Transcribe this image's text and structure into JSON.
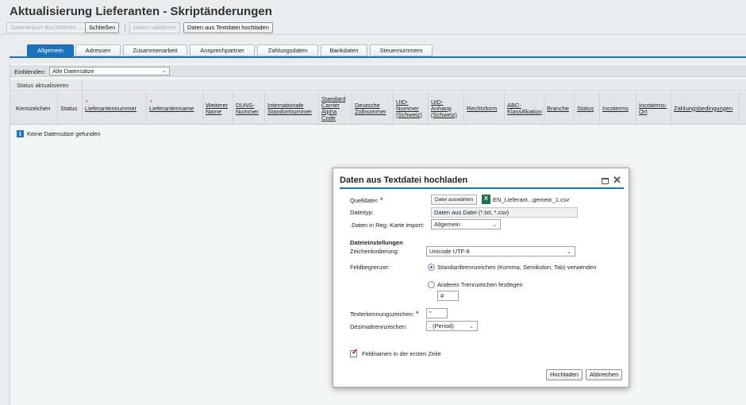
{
  "page": {
    "title": "Aktualisierung Lieferanten - Skriptänderungen"
  },
  "toolbar": {
    "import": "Datenimport durchführen",
    "import_dropdown": "⌄",
    "close": "Schließen",
    "validate": "Daten validieren",
    "upload": "Daten aus Textdatei hochladen"
  },
  "tabs": [
    {
      "label": "Allgemein",
      "active": true
    },
    {
      "label": "Adressen"
    },
    {
      "label": "Zusammenarbeit"
    },
    {
      "label": "Ansprechpartner"
    },
    {
      "label": "Zahlungsdaten"
    },
    {
      "label": "Bankdaten"
    },
    {
      "label": "Steuernummern"
    }
  ],
  "filter": {
    "label": "Einblenden:",
    "value": "Alle Datensätze"
  },
  "table": {
    "group_header": "Status aktualisieren",
    "columns": [
      "Kennzeichen",
      "Status",
      "Lieferantennummer",
      "Lieferantenname",
      "Weiterer Name",
      "DUNS-Nummer",
      "Internationale Standortnummer",
      "Standard Carrier Alpha Code",
      "Deutsche Zollnummer",
      "UID-Nummer (Schweiz)",
      "UID-Anhang (Schweiz)",
      "Rechtsform",
      "ABC-Klassifikation",
      "Branche",
      "Status",
      "Incoterms",
      "Incoterms-Ort",
      "Zahlungsbedingungen"
    ],
    "required_marker": "*",
    "empty_message": "Keine Datensätze gefunden"
  },
  "dialog": {
    "title": "Daten aus Textdatei hochladen",
    "required_marker": "*",
    "source_label": "Quelldatei:",
    "choose_file": "Datei auswählen",
    "file_name": "EN_Lieferant...gemein_1.csv",
    "file_type_label": "Dateityp:",
    "file_type_value": "Daten aus Datei (*.txt, *.csv)",
    "import_tab_label": ".Daten in Reg.-Karte import:",
    "import_tab_value": "Allgemein",
    "section_heading": "Dateieinstellungen",
    "encoding_label": "Zeichenkodierung:",
    "encoding_value": "Unicode UTF-8",
    "delimiter_label": "Feldbegrenzer:",
    "delimiter_standard": "Standardtrennzeichen (Komma, Semikolon, Tab) verwenden",
    "delimiter_other": "Anderes Trennzeichen festlegen",
    "delimiter_other_value": "#",
    "text_qualifier_label": "Texterkennungszeichen:",
    "text_qualifier_value": "\"",
    "decimal_label": "Dezimaltrennzeichen:",
    "decimal_value": ". (Period)",
    "header_checkbox": "Feldnamen in der ersten Zeile",
    "upload_button": "Hochladen",
    "cancel_button": "Abbrechen"
  }
}
